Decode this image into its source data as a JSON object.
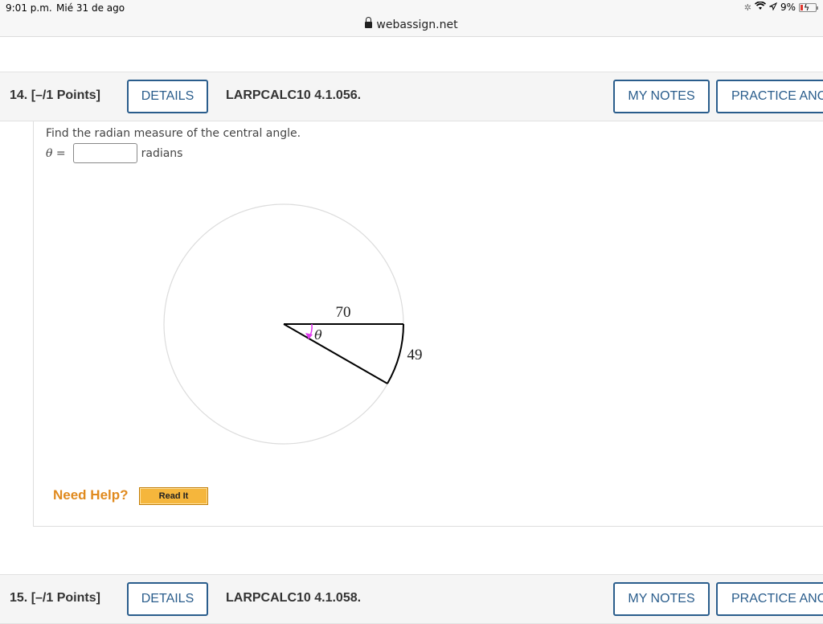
{
  "status_bar": {
    "time": "9:01 p.m.",
    "date": "Mié 31 de ago",
    "battery": "9%"
  },
  "browser": {
    "url": "webassign.net"
  },
  "question_14": {
    "number": "14.  [–/1 Points]",
    "details_label": "DETAILS",
    "code": "LARPCALC10 4.1.056.",
    "my_notes_label": "MY NOTES",
    "practice_label": "PRACTICE ANOTHER",
    "prompt": "Find the radian measure of the central angle.",
    "answer_variable": "θ =",
    "answer_value": "",
    "answer_unit": "radians",
    "figure": {
      "radius_label": "70",
      "arc_label": "49",
      "angle_label": "θ"
    },
    "need_help_label": "Need Help?",
    "read_it_label": "Read It"
  },
  "question_15": {
    "number": "15.  [–/1 Points]",
    "details_label": "DETAILS",
    "code": "LARPCALC10 4.1.058.",
    "my_notes_label": "MY NOTES",
    "practice_label": "PRACTICE ANOTHER"
  },
  "colors": {
    "button_border": "#2a5d8c",
    "need_help": "#e08a1e",
    "read_it_bg": "#f5b63c",
    "angle_arrow": "#e23cf0"
  }
}
